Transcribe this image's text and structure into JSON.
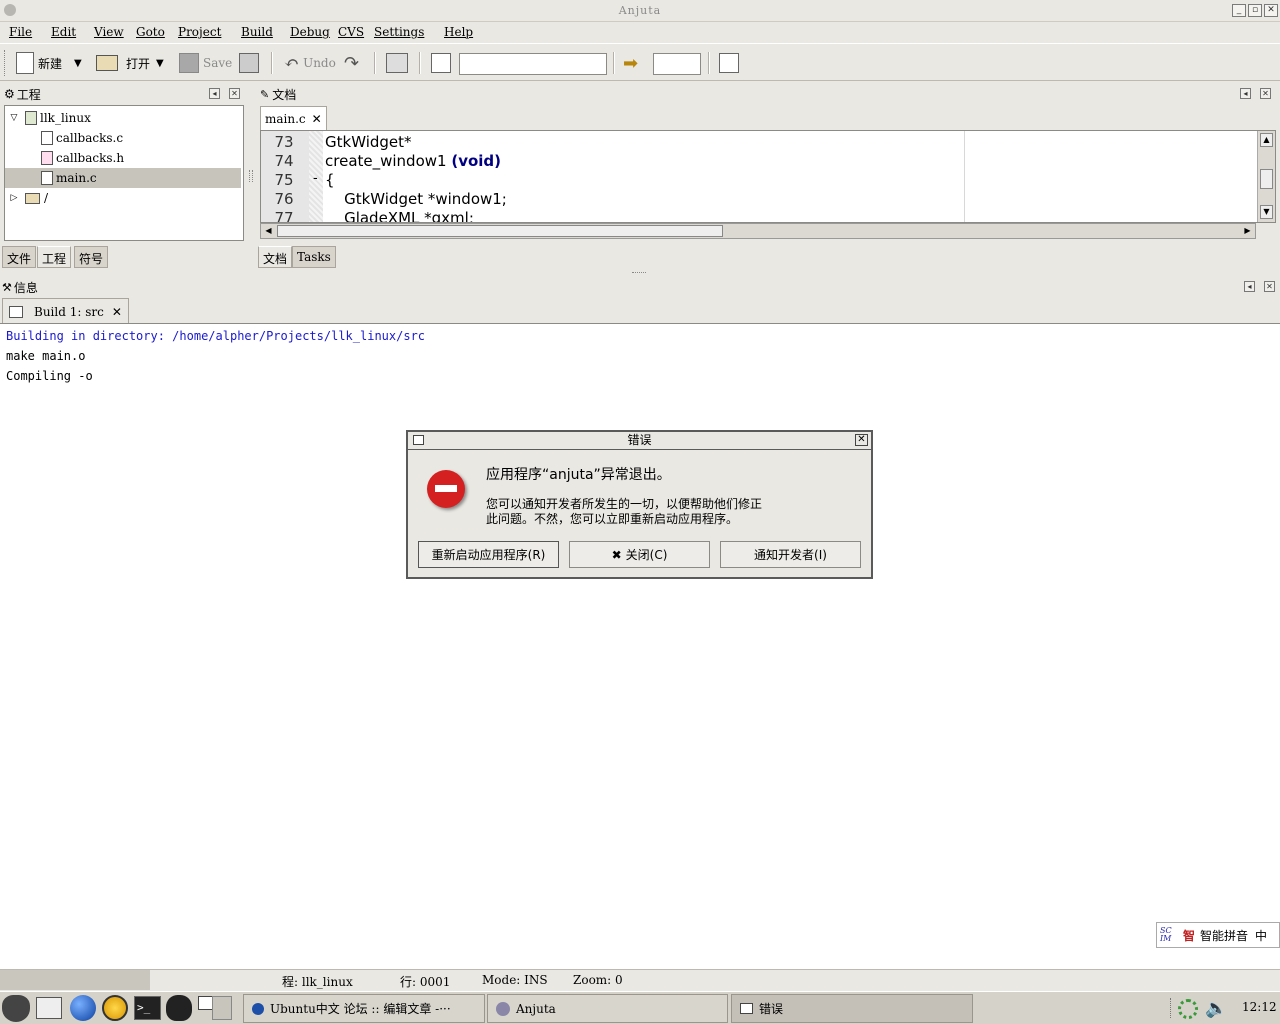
{
  "window": {
    "title": "Anjuta",
    "btn_min": "_",
    "btn_max": "▫",
    "btn_close": "✕"
  },
  "menu": [
    "File",
    "Edit",
    "View",
    "Goto",
    "Project",
    "Build",
    "Debug",
    "CVS",
    "Settings",
    "Help"
  ],
  "toolbar": {
    "new_label": "新建",
    "open_label": "打开",
    "save_label": "Save",
    "undo_label": "Undo",
    "search_value": "",
    "goto_value": ""
  },
  "project_panel": {
    "title": "工程",
    "tree": [
      {
        "label": "llk_linux",
        "type": "project"
      },
      {
        "label": "callbacks.c",
        "type": "c-file"
      },
      {
        "label": "callbacks.h",
        "type": "h-file"
      },
      {
        "label": "main.c",
        "type": "c-file",
        "selected": true
      },
      {
        "label": "/",
        "type": "folder"
      }
    ],
    "tabs": [
      "文件",
      "工程",
      "符号"
    ],
    "active_tab": "工程"
  },
  "doc_panel": {
    "title": "文档",
    "open_tab": "main.c",
    "close_icon": "✕",
    "tabs": [
      "文档",
      "Tasks"
    ],
    "lines": [
      {
        "n": "73",
        "text": "GtkWidget*"
      },
      {
        "n": "74",
        "text": "create_window1 ",
        "kw": "(void)"
      },
      {
        "n": "75",
        "text": "{",
        "fold": "-"
      },
      {
        "n": "76",
        "text": "    GtkWidget *window1;"
      },
      {
        "n": "77",
        "text": "    GladeXML *gxml;"
      }
    ]
  },
  "msg_panel": {
    "title": "信息",
    "tab": "Build 1: src",
    "lines": [
      {
        "text": "Building in directory: /home/alpher/Projects/llk_linux/src",
        "color": "#1a1ad0"
      },
      {
        "text": "make main.o",
        "color": "#000000"
      },
      {
        "text": "Compiling -o",
        "color": "#000000"
      }
    ]
  },
  "dialog": {
    "title": "错误",
    "heading": "应用程序“anjuta”异常退出。",
    "body_line1": "您可以通知开发者所发生的一切，以便帮助他们修正",
    "body_line2": "此问题。不然，您可以立即重新启动应用程序。",
    "restart_button": "重新启动应用程序(R)",
    "close_button": "关闭(C)",
    "notify_button": "通知开发者(I)",
    "error_color": "#d42020"
  },
  "ime": {
    "logo": "SC IM",
    "zhi": "智",
    "label": "智能拼音",
    "mode": "中"
  },
  "status": {
    "project": "程: llk_linux",
    "line": "行: 0001",
    "mode": "Mode: INS",
    "zoom": "Zoom: 0"
  },
  "taskbar": {
    "tasks": [
      {
        "label": "Ubuntu中文 论坛 :: 编辑文章 -···"
      },
      {
        "label": "Anjuta"
      },
      {
        "label": "错误",
        "active": true
      }
    ],
    "clock": "12:12"
  }
}
